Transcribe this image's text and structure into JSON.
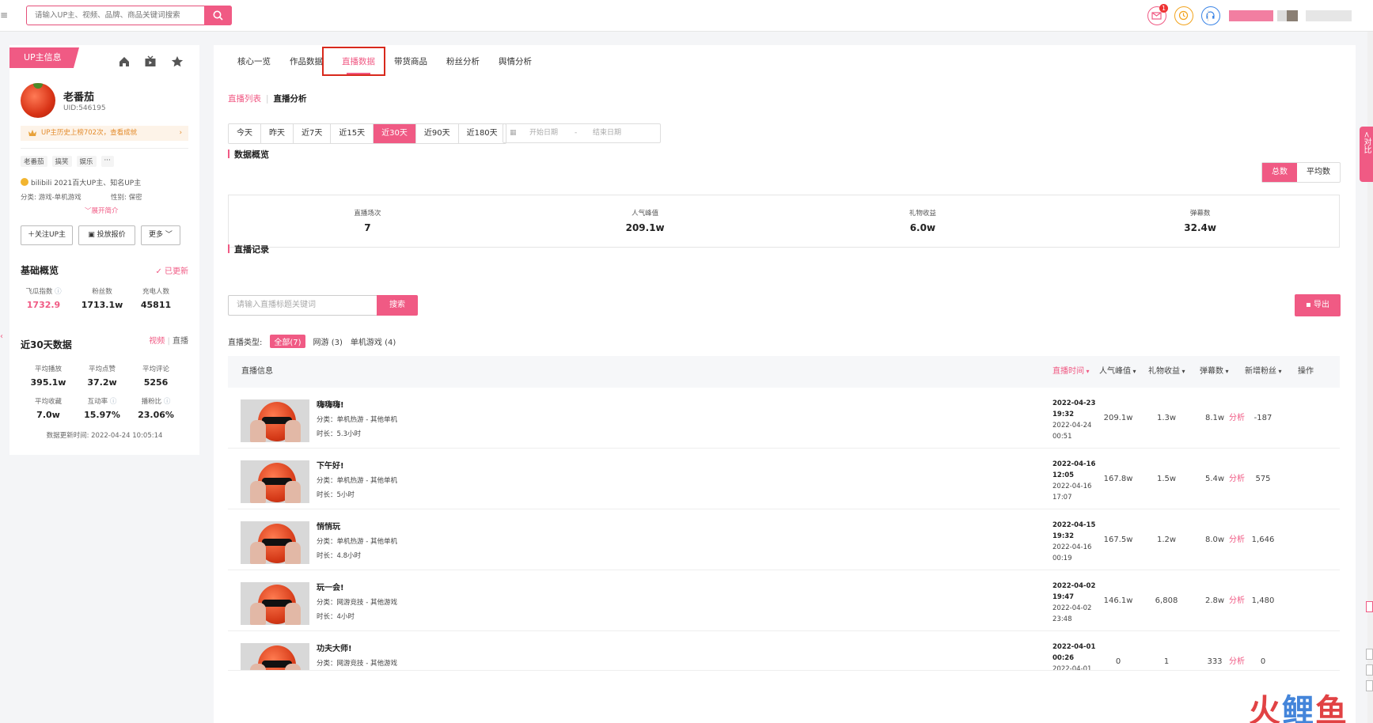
{
  "search": {
    "placeholder": "请输入UP主、视频、品牌、商品关键词搜索"
  },
  "topbar": {
    "message_badge": "1"
  },
  "sidebar": {
    "up_tag": "UP主信息",
    "name": "老番茄",
    "uid": "UID:546195",
    "history": "UP主历史上榜702次，查看成就",
    "tags": [
      "老番茄",
      "搞笑",
      "娱乐",
      "···"
    ],
    "award": "bilibili 2021百大UP主、知名UP主",
    "category": "分类: 游戏-单机游戏",
    "gender": "性别: 保密",
    "expand": "展开简介",
    "buttons": {
      "follow": "关注UP主",
      "quote": "投放报价",
      "more": "更多"
    },
    "basic": {
      "title": "基础概览",
      "updated": "已更新",
      "stats": [
        {
          "label": "飞瓜指数",
          "value": "1732.9"
        },
        {
          "label": "粉丝数",
          "value": "1713.1w"
        },
        {
          "label": "充电人数",
          "value": "45811"
        }
      ]
    },
    "recent": {
      "title": "近30天数据",
      "tab_video": "视频",
      "tab_live": "直播",
      "stats": [
        {
          "label": "平均播放",
          "value": "395.1w"
        },
        {
          "label": "平均点赞",
          "value": "37.2w"
        },
        {
          "label": "平均评论",
          "value": "5256"
        },
        {
          "label": "平均收藏",
          "value": "7.0w"
        },
        {
          "label": "互动率",
          "value": "15.97%"
        },
        {
          "label": "播粉比",
          "value": "23.06%"
        }
      ],
      "update_time": "数据更新时间:  2022-04-24 10:05:14"
    }
  },
  "main": {
    "tabs": [
      "核心一览",
      "作品数据",
      "直播数据",
      "带货商品",
      "粉丝分析",
      "舆情分析"
    ],
    "subnav": {
      "list": "直播列表",
      "analysis": "直播分析"
    },
    "ranges": [
      "今天",
      "昨天",
      "近7天",
      "近15天",
      "近30天",
      "近90天",
      "近180天"
    ],
    "date_start": "开始日期",
    "date_end": "结束日期",
    "overview": {
      "title": "数据概览",
      "toggle": [
        "总数",
        "平均数"
      ],
      "items": [
        {
          "label": "直播场次",
          "value": "7"
        },
        {
          "label": "人气峰值",
          "value": "209.1w"
        },
        {
          "label": "礼物收益",
          "value": "6.0w"
        },
        {
          "label": "弹幕数",
          "value": "32.4w"
        }
      ]
    },
    "records": {
      "title": "直播记录",
      "keyword_placeholder": "请输入直播标题关键词",
      "search_btn": "搜索",
      "export_btn": "导出",
      "type_label": "直播类型:",
      "types": [
        "全部(7)",
        "网游 (3)",
        "单机游戏 (4)"
      ],
      "headers": {
        "info": "直播信息",
        "time": "直播时间",
        "peak": "人气峰值",
        "gift": "礼物收益",
        "danmu": "弹幕数",
        "fans": "新增粉丝",
        "op": "操作"
      },
      "rows": [
        {
          "title": "嗨嗨嗨!",
          "category": "分类：单机热游 - 其他单机",
          "duration": "时长：5.3小时",
          "start_date": "2022-04-23",
          "start_time": "19:32",
          "end_date": "2022-04-24",
          "end_time": "00:51",
          "peak": "209.1w",
          "gift": "1.3w",
          "danmu": "8.1w",
          "fans": "-187",
          "op": "分析"
        },
        {
          "title": "下午好!",
          "category": "分类：单机热游 - 其他单机",
          "duration": "时长：5小时",
          "start_date": "2022-04-16",
          "start_time": "12:05",
          "end_date": "2022-04-16",
          "end_time": "17:07",
          "peak": "167.8w",
          "gift": "1.5w",
          "danmu": "5.4w",
          "fans": "575",
          "op": "分析"
        },
        {
          "title": "悄悄玩",
          "category": "分类：单机热游 - 其他单机",
          "duration": "时长：4.8小时",
          "start_date": "2022-04-15",
          "start_time": "19:32",
          "end_date": "2022-04-16",
          "end_time": "00:19",
          "peak": "167.5w",
          "gift": "1.2w",
          "danmu": "8.0w",
          "fans": "1,646",
          "op": "分析"
        },
        {
          "title": "玩一会!",
          "category": "分类：网游竞技 - 其他游戏",
          "duration": "时长：4小时",
          "start_date": "2022-04-02",
          "start_time": "19:47",
          "end_date": "2022-04-02",
          "end_time": "23:48",
          "peak": "146.1w",
          "gift": "6,808",
          "danmu": "2.8w",
          "fans": "1,480",
          "op": "分析"
        },
        {
          "title": "功夫大师!",
          "category": "分类：网游竞技 - 其他游戏",
          "duration": "",
          "start_date": "2022-04-01",
          "start_time": "00:26",
          "end_date": "2022-04-01",
          "end_time": "",
          "peak": "0",
          "gift": "1",
          "danmu": "333",
          "fans": "0",
          "op": "分析"
        }
      ]
    }
  },
  "right_float": "<对比",
  "watermark": {
    "part1": "火",
    "part2": "鲤",
    "part3": "鱼"
  },
  "colors": {
    "accent": "#f05a84",
    "highlight_box": "#d8291c"
  }
}
